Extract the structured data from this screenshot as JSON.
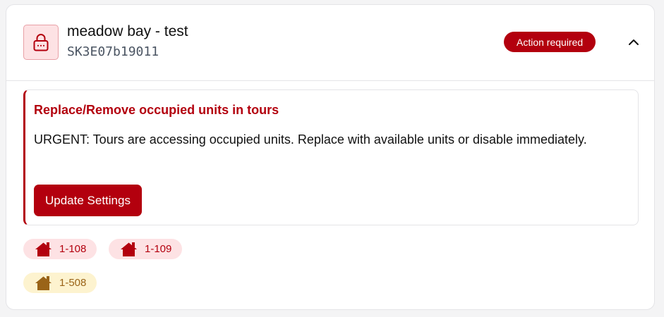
{
  "site": {
    "name": "meadow bay - test",
    "code": "SK3E07b19011",
    "status": "Action required",
    "lock_icon": "lock-icon",
    "toggle_icon": "chevron-up-icon"
  },
  "alert": {
    "title": "Replace/Remove occupied units in tours",
    "message": "URGENT: Tours are accessing occupied units. Replace with available units or disable immediately.",
    "button_label": "Update Settings"
  },
  "units": [
    {
      "label": "1-108",
      "state": "occupied",
      "icon": "house-icon"
    },
    {
      "label": "1-109",
      "state": "occupied",
      "icon": "house-icon"
    },
    {
      "label": "1-508",
      "state": "pending",
      "icon": "house-icon"
    }
  ],
  "colors": {
    "accent_red": "#b3000e",
    "chip_red_bg": "#fde2e4",
    "chip_amber_bg": "#fdf3cf",
    "chip_amber_text": "#9a6418"
  }
}
